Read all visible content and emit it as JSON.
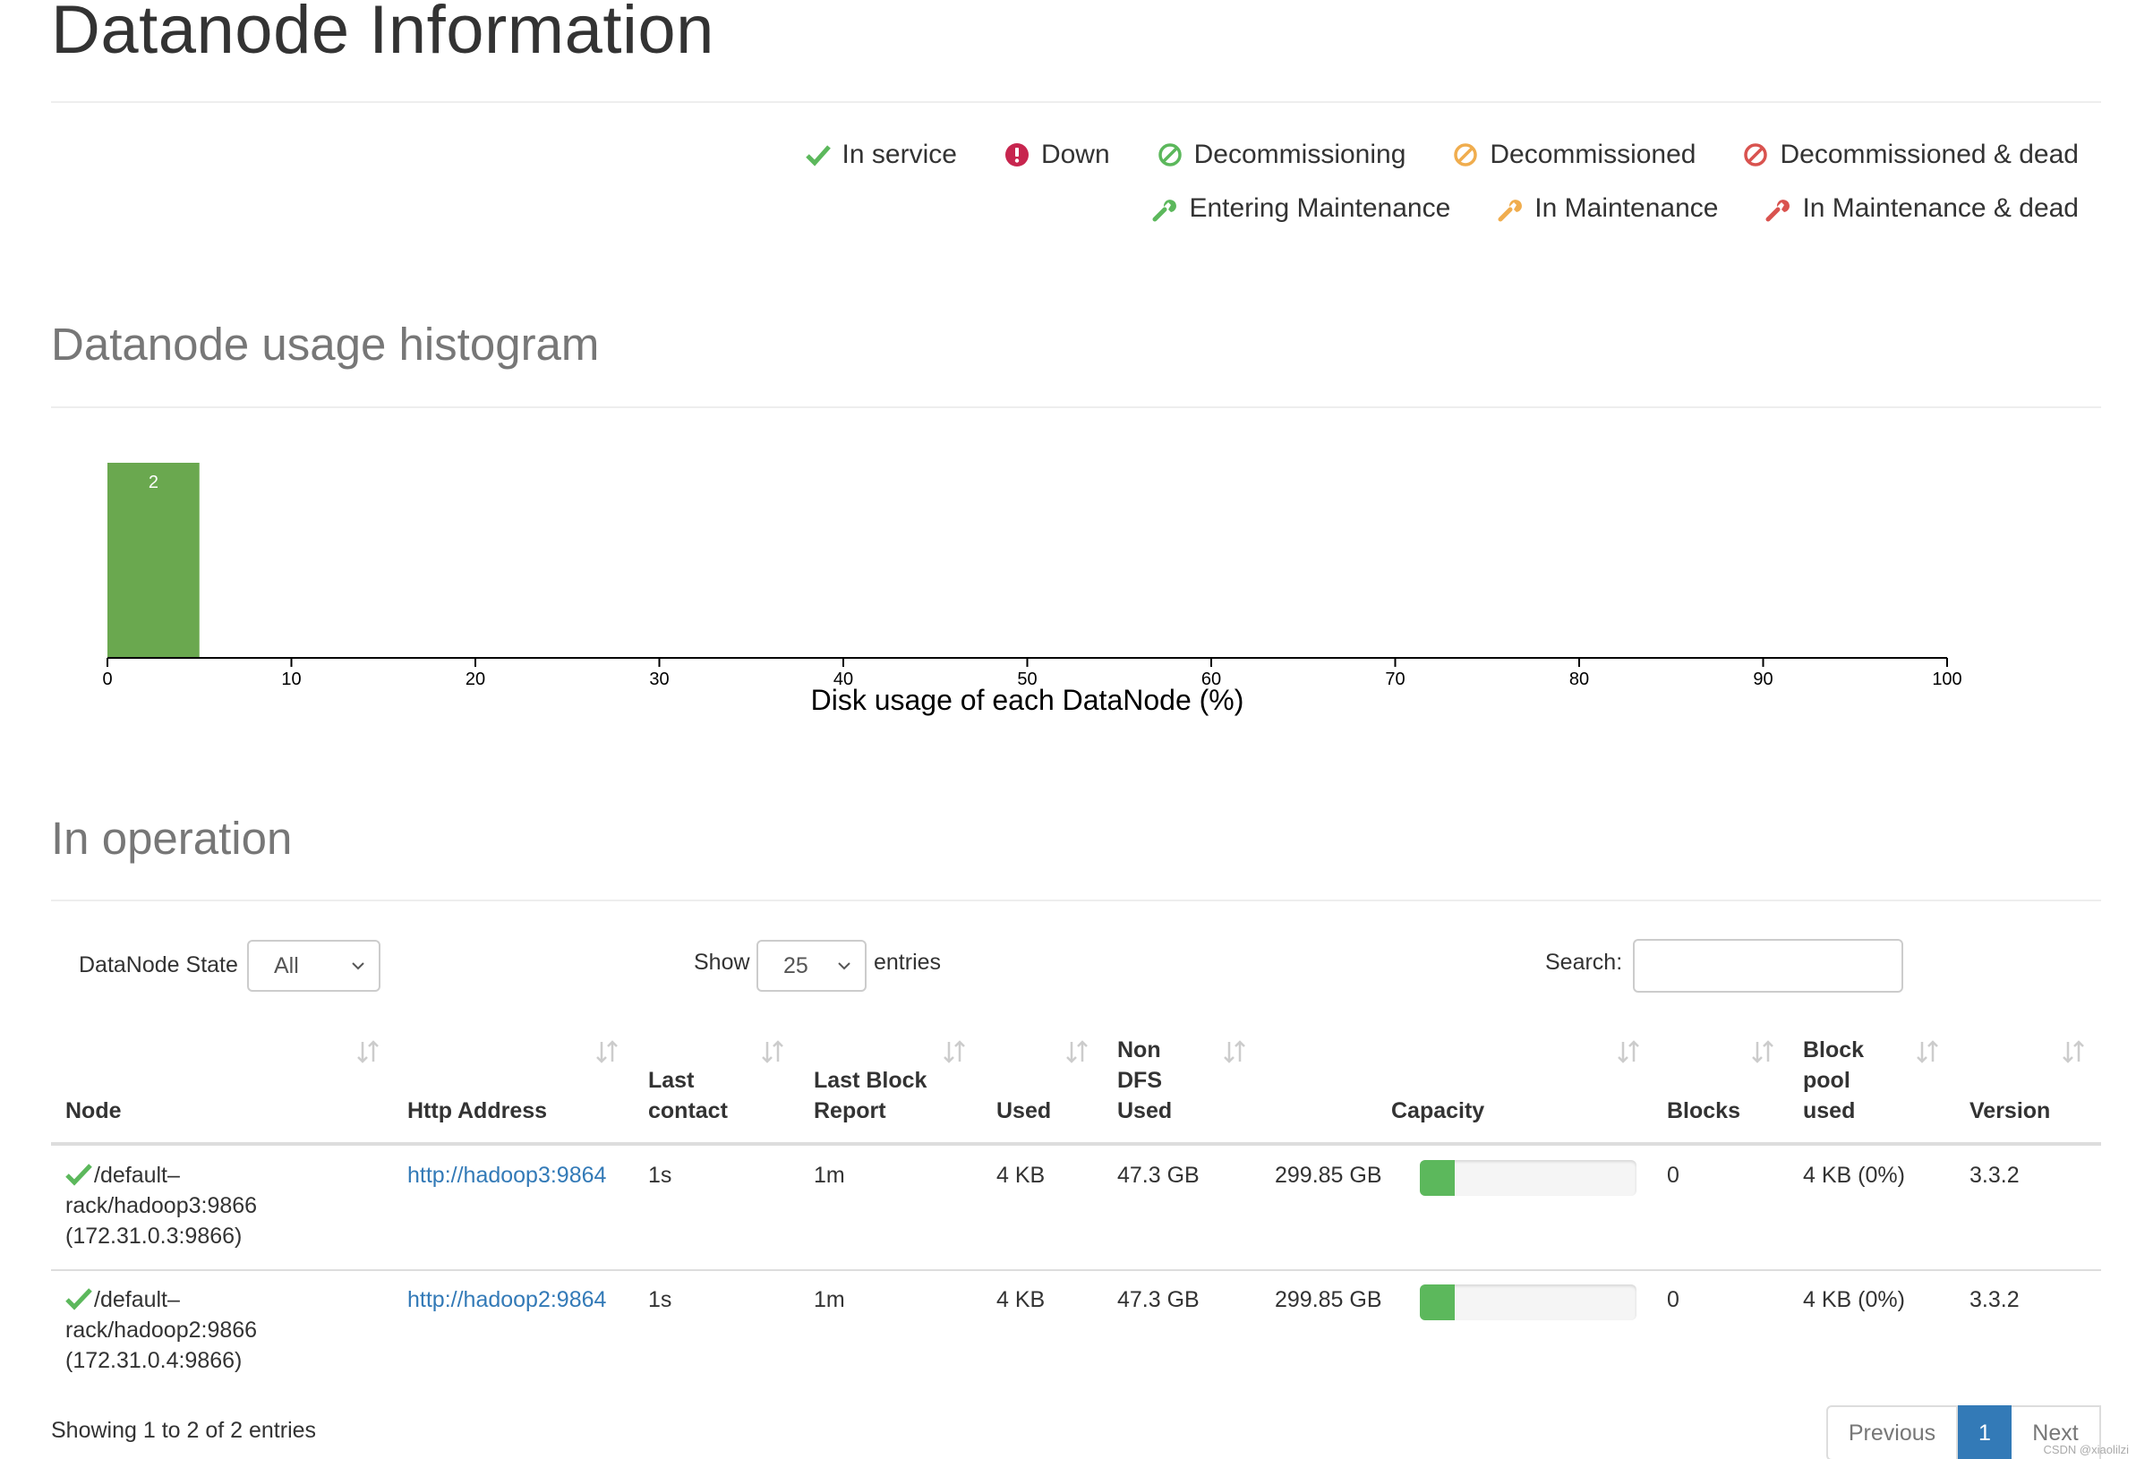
{
  "page": {
    "title": "Datanode Information"
  },
  "legend": {
    "row1": [
      {
        "label": "In service",
        "icon": "check-icon",
        "color": "#5cb85c"
      },
      {
        "label": "Down",
        "icon": "exclamation-circle-icon",
        "color": "#c7254e"
      },
      {
        "label": "Decommissioning",
        "icon": "ban-icon",
        "color": "#5cb85c"
      },
      {
        "label": "Decommissioned",
        "icon": "ban-icon",
        "color": "#f0ad4e"
      },
      {
        "label": "Decommissioned & dead",
        "icon": "ban-icon",
        "color": "#d9534f"
      }
    ],
    "row2": [
      {
        "label": "Entering Maintenance",
        "icon": "wrench-icon",
        "color": "#5cb85c"
      },
      {
        "label": "In Maintenance",
        "icon": "wrench-icon",
        "color": "#f0ad4e"
      },
      {
        "label": "In Maintenance & dead",
        "icon": "wrench-icon",
        "color": "#d9534f"
      }
    ]
  },
  "histogram": {
    "heading": "Datanode usage histogram"
  },
  "chart_data": {
    "type": "bar",
    "title": "",
    "xlabel": "Disk usage of each DataNode (%)",
    "ylabel": "",
    "xlim": [
      0,
      100
    ],
    "xticks": [
      0,
      10,
      20,
      30,
      40,
      50,
      60,
      70,
      80,
      90,
      100
    ],
    "bins": [
      {
        "x0": 0,
        "x1": 5,
        "count": 2
      }
    ],
    "bar_color": "#6aa84f",
    "grid": false
  },
  "operation": {
    "heading": "In operation",
    "state_label": "DataNode State",
    "state_value": "All",
    "show_label": "Show",
    "show_value": "25",
    "entries_label": "entries",
    "search_label": "Search:",
    "search_value": "",
    "columns": [
      [
        "Node"
      ],
      [
        "Http Address"
      ],
      [
        "Last",
        "contact"
      ],
      [
        "Last Block",
        "Report"
      ],
      [
        "Used"
      ],
      [
        "Non",
        "DFS",
        "Used"
      ],
      [
        "Capacity"
      ],
      [
        "Blocks"
      ],
      [
        "Block",
        "pool",
        "used"
      ],
      [
        "Version"
      ]
    ],
    "rows": [
      {
        "node_lines": [
          "/default–",
          "rack/hadoop3:9866",
          "(172.31.0.3:9866)"
        ],
        "http": "http://hadoop3:9864",
        "last_contact": "1s",
        "last_block_report": "1m",
        "used": "4 KB",
        "non_dfs_used": "47.3 GB",
        "capacity": "299.85 GB",
        "capacity_used_fraction": 0.16,
        "blocks": "0",
        "block_pool_used": "4 KB (0%)",
        "version": "3.3.2"
      },
      {
        "node_lines": [
          "/default–",
          "rack/hadoop2:9866",
          "(172.31.0.4:9866)"
        ],
        "http": "http://hadoop2:9864",
        "last_contact": "1s",
        "last_block_report": "1m",
        "used": "4 KB",
        "non_dfs_used": "47.3 GB",
        "capacity": "299.85 GB",
        "capacity_used_fraction": 0.16,
        "blocks": "0",
        "block_pool_used": "4 KB (0%)",
        "version": "3.3.2"
      }
    ],
    "info": "Showing 1 to 2 of 2 entries",
    "pagination": {
      "previous": "Previous",
      "current": "1",
      "next": "Next"
    }
  },
  "watermark": "CSDN @xiaolilzi"
}
